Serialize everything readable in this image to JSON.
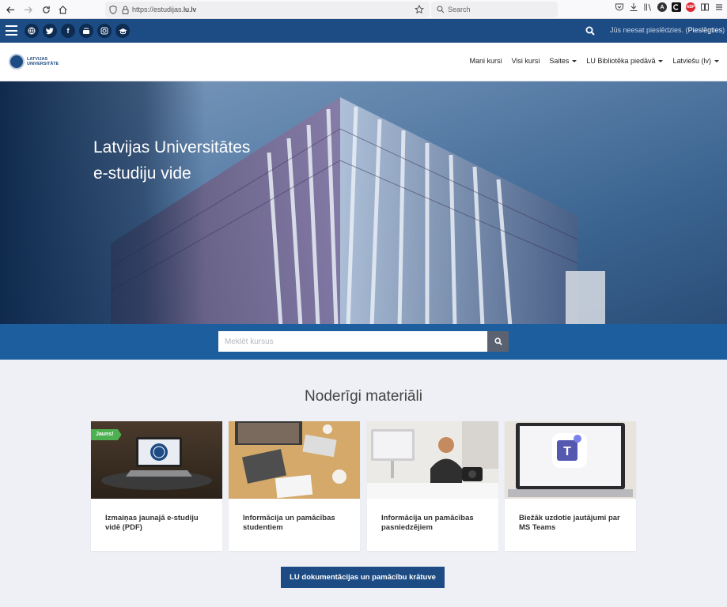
{
  "browser": {
    "url_prefix": "https://estudijas.",
    "url_domain": "lu.lv",
    "search_placeholder": "Search",
    "extensions": [
      "A",
      "ABP"
    ]
  },
  "topbar": {
    "social_icons": [
      "globe-icon",
      "twitter-icon",
      "facebook-icon",
      "youtube-icon",
      "instagram-icon",
      "graduation-cap-icon"
    ],
    "login_prefix": "Jūs neesat pieslēdzies. (",
    "login_link": "Pieslēgties",
    "login_suffix": ")"
  },
  "logo": {
    "line1": "LATVIJAS",
    "line2": "UNIVERSITĀTE"
  },
  "nav": {
    "items": [
      {
        "label": "Mani kursi",
        "dropdown": false
      },
      {
        "label": "Visi kursi",
        "dropdown": false
      },
      {
        "label": "Saites",
        "dropdown": true
      },
      {
        "label": "LU Bibliotēka piedāvā",
        "dropdown": true
      },
      {
        "label": "Latviešu (lv)",
        "dropdown": true
      }
    ]
  },
  "hero": {
    "title_line1": "Latvijas Universitātes",
    "title_line2": "e-studiju vide"
  },
  "course_search": {
    "placeholder": "Meklēt kursus"
  },
  "materials": {
    "title": "Noderīgi materiāli",
    "cards": [
      {
        "caption": "Izmaiņas jaunajā e-studiju vidē (PDF)",
        "badge": "Jauns!"
      },
      {
        "caption": "Informācija un pamācības studentiem",
        "badge": ""
      },
      {
        "caption": "Informācija un pamācības pasniedzējiem",
        "badge": ""
      },
      {
        "caption": "Biežāk uzdotie jautājumi par MS Teams",
        "badge": ""
      }
    ]
  },
  "docs_button": {
    "label": "LU dokumentācijas un pamācību krātuve"
  },
  "colors": {
    "brand": "#1d4c84",
    "search_band": "#1d5e9e",
    "badge": "#4caf50"
  }
}
